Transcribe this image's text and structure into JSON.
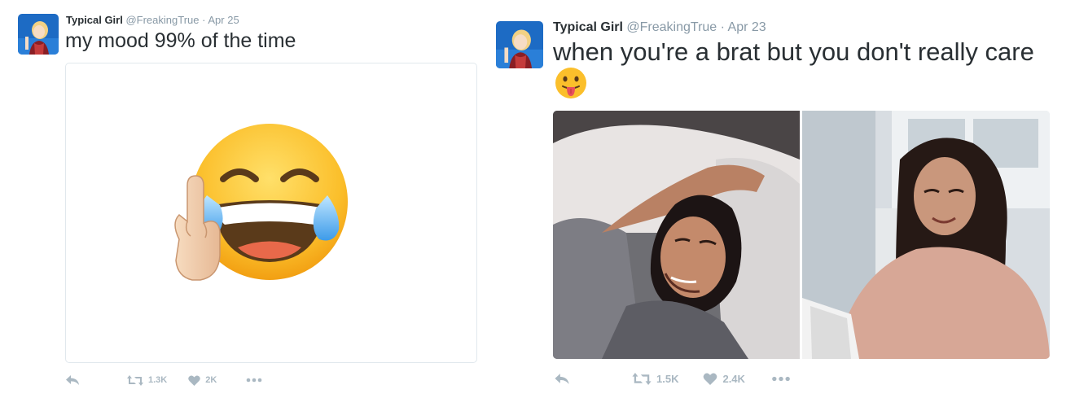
{
  "tweets": [
    {
      "author_name": "Typical Girl",
      "handle": "@FreakingTrue",
      "separator": "·",
      "date": "Apr 25",
      "text": "my mood 99% of the time",
      "media": "laughing-crying-emoji-with-middle-finger",
      "actions": {
        "retweets": "1.3K",
        "likes": "2K"
      }
    },
    {
      "author_name": "Typical Girl",
      "handle": "@FreakingTrue",
      "separator": "·",
      "date": "Apr 23",
      "text": "when you're a brat but you don't really care",
      "emoji": "face-with-tongue",
      "media": [
        "woman-laughing-in-bed-photo",
        "woman-smiling-at-laptop-photo"
      ],
      "actions": {
        "retweets": "1.5K",
        "likes": "2.4K"
      }
    }
  ],
  "icons": {
    "reply": "reply-icon",
    "retweet": "retweet-icon",
    "like": "heart-icon",
    "more": "more-icon"
  },
  "colors": {
    "text": "#292f33",
    "muted": "#8899a6",
    "action_gray": "#aab8c2",
    "border": "#e1e8ed"
  }
}
